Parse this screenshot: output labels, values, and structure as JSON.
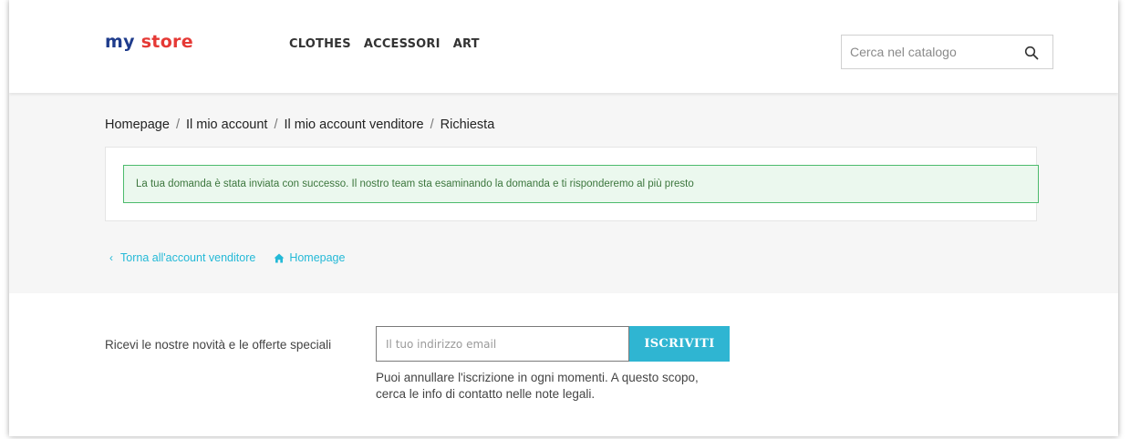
{
  "header": {
    "logo": {
      "part1": "my ",
      "part2": "store"
    },
    "nav": [
      {
        "label": "CLOTHES"
      },
      {
        "label": "ACCESSORI"
      },
      {
        "label": "ART"
      }
    ],
    "search": {
      "placeholder": "Cerca nel catalogo",
      "icon": "search-icon"
    }
  },
  "breadcrumb": {
    "items": [
      "Homepage",
      "Il mio account",
      "Il mio account venditore",
      "Richiesta"
    ],
    "separator": "/"
  },
  "alert": {
    "message": "La tua domanda è stata inviata con successo. Il nostro team sta esaminando la domanda e ti risponderemo al più presto",
    "color": "#4cbb6c"
  },
  "links": {
    "back": {
      "chevron": "‹",
      "label": "Torna all'account venditore"
    },
    "home": {
      "icon": "home-icon",
      "label": "Homepage"
    },
    "color": "#24b9d7"
  },
  "newsletter": {
    "label": "Ricevi le nostre novità e le offerte speciali",
    "email_placeholder": "Il tuo indirizzo email",
    "button_label": "ISCRIVITI",
    "note": "Puoi annullare l'iscrizione in ogni momenti. A questo scopo, cerca le info di contatto nelle note legali.",
    "accent_color": "#2fb5d2"
  }
}
